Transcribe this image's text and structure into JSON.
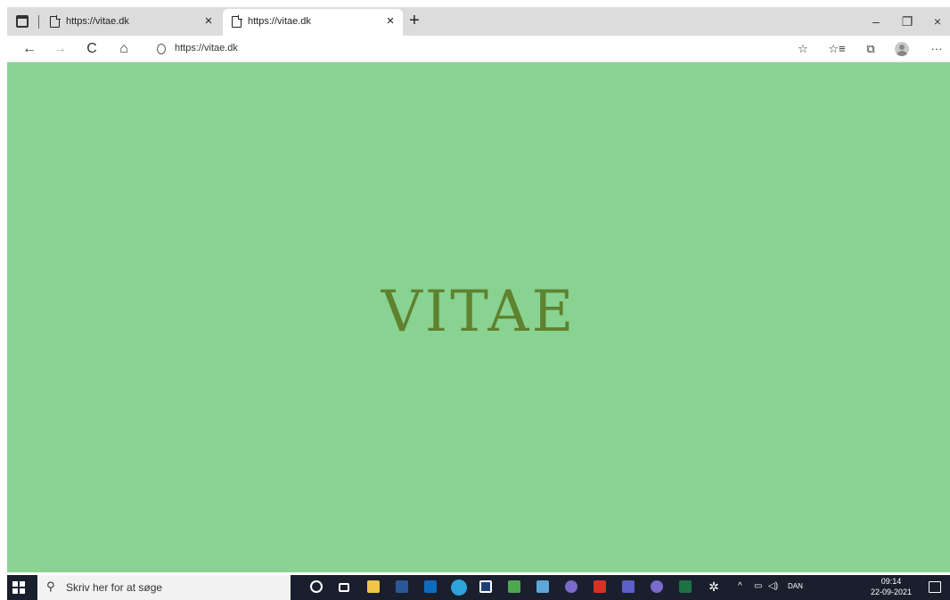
{
  "browser": {
    "tabs": [
      {
        "title": "https://vitae.dk",
        "active": false
      },
      {
        "title": "https://vitae.dk",
        "active": true
      }
    ],
    "new_tab_label": "+",
    "close_glyph": "×",
    "window_controls": {
      "minimize": "–",
      "restore": "❐",
      "close": "×"
    },
    "nav": {
      "back": "←",
      "forward": "→",
      "refresh": "C",
      "home": "⌂"
    },
    "address_url": "https://vitae.dk",
    "toolbar_icons": [
      "add-to-favorites-icon",
      "favorites-icon",
      "collections-icon",
      "profile-avatar-icon",
      "more-icon"
    ],
    "more_glyph": "···"
  },
  "page": {
    "logo_text": "VITAE",
    "background_color": "#89d392",
    "logo_color": "#5f822f"
  },
  "taskbar": {
    "search_placeholder": "Skriv her for at søge",
    "tray": {
      "language": "DAN",
      "time": "09:14",
      "date": "22-09-2021"
    },
    "pinned_icons": [
      "cortana-icon",
      "task-view-icon",
      "file-explorer-icon",
      "word-icon",
      "outlook-icon",
      "edge-icon",
      "app-icon",
      "app-icon",
      "app-icon",
      "app-icon",
      "acrobat-icon",
      "teams-icon",
      "app-icon",
      "excel-icon",
      "settings-icon"
    ]
  }
}
